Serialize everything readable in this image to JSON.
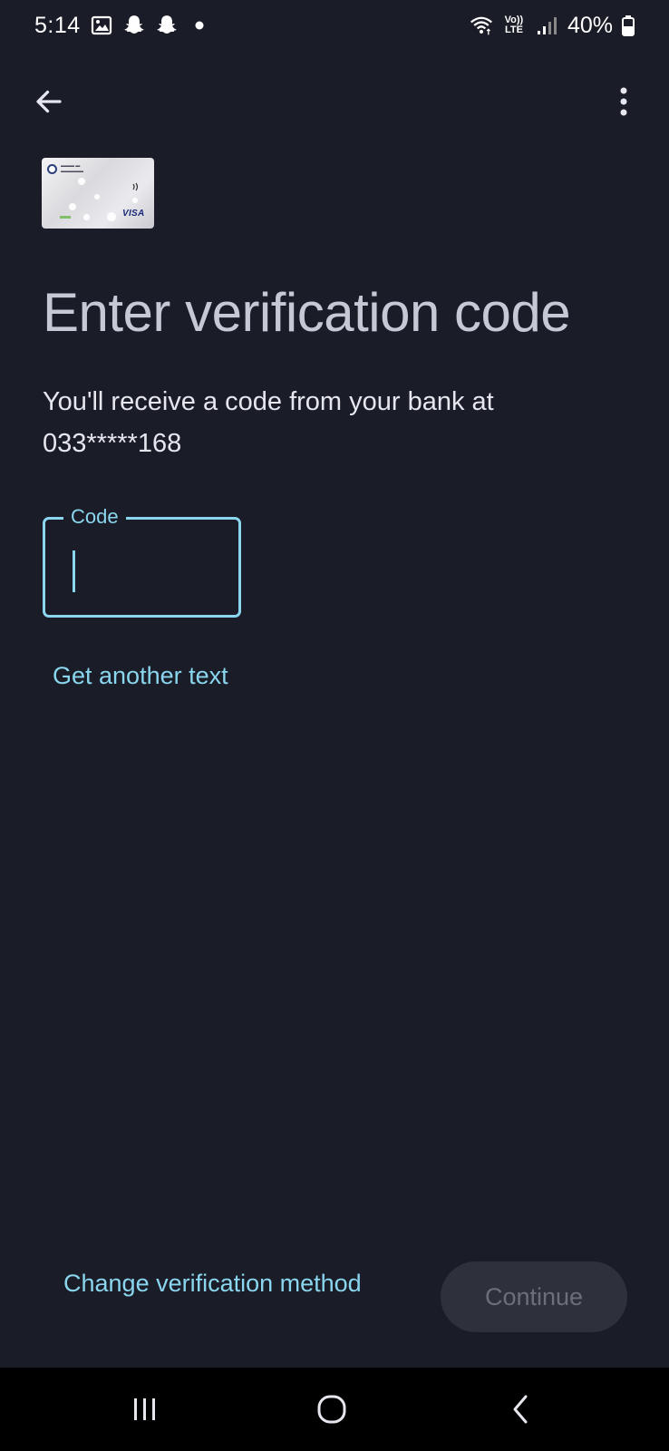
{
  "status_bar": {
    "time": "5:14",
    "network_label": "Vo)) LTE",
    "battery": "40%",
    "icons": [
      "image-icon",
      "snapchat-icon",
      "snapchat-icon",
      "notification-dot-icon",
      "wifi-icon",
      "volte-icon",
      "signal-icon",
      "battery-icon"
    ]
  },
  "app_bar": {
    "back_icon": "arrow-back-icon",
    "menu_icon": "more-vert-icon"
  },
  "card": {
    "network": "VISA"
  },
  "page": {
    "title": "Enter verification code",
    "subtitle": "You'll receive a code from your bank at 033*****168"
  },
  "code_field": {
    "label": "Code",
    "value": ""
  },
  "actions": {
    "get_another_text": "Get another text",
    "change_method": "Change verification method",
    "continue": "Continue"
  },
  "colors": {
    "background": "#1a1c27",
    "accent": "#8ad6ee",
    "title": "#c6c8d6",
    "button_disabled_bg": "#2e303c",
    "button_disabled_text": "#6c6e7a"
  },
  "nav_bar": {
    "items": [
      "recents-icon",
      "home-icon",
      "back-icon"
    ]
  }
}
